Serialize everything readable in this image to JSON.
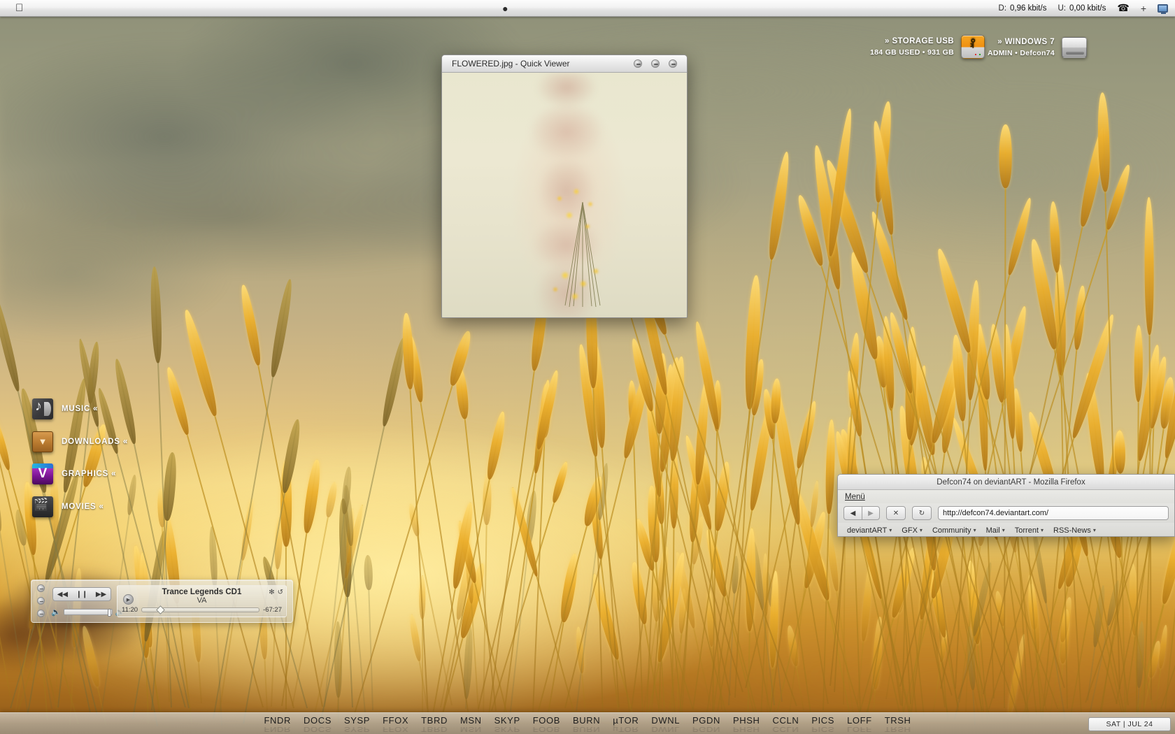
{
  "menubar": {
    "apple_logo": "",
    "firefox_icon": "firefox-icon",
    "download_label": "D:",
    "download_value": "0,96 kbit/s",
    "upload_label": "U:",
    "upload_value": "0,00 kbit/s",
    "phone_icon": "phone-icon",
    "plus_icon": "+",
    "display_icon": "monitor-icon"
  },
  "drives": [
    {
      "name": "» STORAGE USB",
      "detail": "184 GB USED • 931 GB",
      "icon": "usb-drive-icon"
    },
    {
      "name": "» WINDOWS 7",
      "detail": "ADMIN • Defcon74",
      "icon": "hard-drive-icon"
    }
  ],
  "desktop_icons": [
    {
      "label": "MUSIC «",
      "icon": "music-folder-icon"
    },
    {
      "label": "DOWNLOADS «",
      "icon": "downloads-folder-icon"
    },
    {
      "label": "GRAPHICS «",
      "icon": "graphics-folder-icon"
    },
    {
      "label": "MOVIES «",
      "icon": "movies-folder-icon"
    }
  ],
  "quickviewer": {
    "title": "FLOWERED.jpg - Quick Viewer",
    "buttons": [
      "minimize-button",
      "zoom-button",
      "close-button"
    ]
  },
  "firefox": {
    "title": "Defcon74 on deviantART - Mozilla Firefox",
    "menu_label": "Menü",
    "back_icon": "◀",
    "forward_icon": "▶",
    "stop_icon": "✕",
    "reload_icon": "↻",
    "url": "http://defcon74.deviantart.com/",
    "bookmarks": [
      {
        "label": "deviantART",
        "caret": "▾"
      },
      {
        "label": "GFX",
        "caret": "▾"
      },
      {
        "label": "Community",
        "caret": "▾"
      },
      {
        "label": "Mail",
        "caret": "▾"
      },
      {
        "label": "Torrent",
        "caret": "▾"
      },
      {
        "label": "RSS-News",
        "caret": "▾"
      }
    ]
  },
  "player": {
    "prev_icon": "◀◀",
    "play_pause_icon": "❙❙",
    "next_icon": "▶▶",
    "play_small_icon": "▶",
    "track_title": "Trance Legends CD1",
    "track_artist": "VA",
    "elapsed": "11:20",
    "remaining": "-67:27",
    "shuffle_icon": "✻",
    "repeat_icon": "↺",
    "volume_low_icon": "🔈",
    "volume_high_icon": "🔊"
  },
  "dock": {
    "items": [
      {
        "label": "FNDR",
        "running": false
      },
      {
        "label": "DOCS",
        "running": false
      },
      {
        "label": "SYSP",
        "running": false
      },
      {
        "label": "FFOX",
        "running": true
      },
      {
        "label": "TBRD",
        "running": false
      },
      {
        "label": "MSN",
        "running": false
      },
      {
        "label": "SKYP",
        "running": false
      },
      {
        "label": "FOOB",
        "running": true
      },
      {
        "label": "BURN",
        "running": false
      },
      {
        "label": "µTOR",
        "running": false
      },
      {
        "label": "DWNL",
        "running": true
      },
      {
        "label": "PGDN",
        "running": false
      },
      {
        "label": "PHSH",
        "running": false
      },
      {
        "label": "CCLN",
        "running": false
      },
      {
        "label": "PICS",
        "running": false
      },
      {
        "label": "LOFF",
        "running": false
      },
      {
        "label": "TRSH",
        "running": false
      }
    ],
    "clock": "SAT | JUL 24"
  },
  "colors": {
    "accent_orange": "#ef8f10",
    "dock_bg": "#bab9b4",
    "menubar_bg": "#ececec"
  }
}
